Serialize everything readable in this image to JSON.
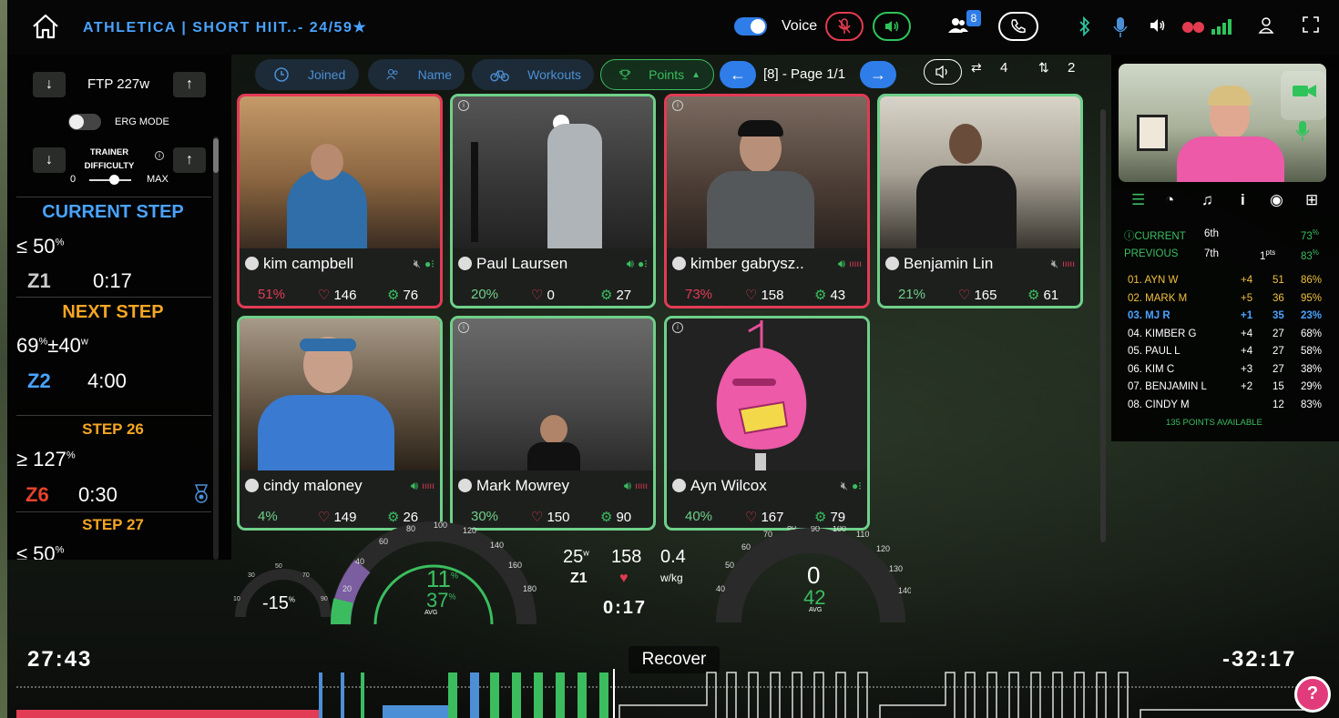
{
  "header": {
    "title": "ATHLETICA | SHORT HIIT..- 24/59★",
    "voice_label": "Voice",
    "participant_count": "8"
  },
  "left": {
    "ftp": "FTP 227w",
    "erg_label": "ERG MODE",
    "trainer_label_1": "TRAINER",
    "trainer_label_2": "DIFFICULTY",
    "min_label": "0",
    "max_label": "MAX",
    "current_step_title": "CURRENT STEP",
    "current_target": "≤ 50",
    "current_target_unit": "%",
    "current_zone": "Z1",
    "current_time": "0:17",
    "next_step_title": "NEXT STEP",
    "next_target": "69",
    "next_target_sup": "%",
    "next_target_range": "±40",
    "next_target_unit": "w",
    "next_zone": "Z2",
    "next_time": "4:00",
    "step26_title": "STEP 26",
    "step26_target": "≥ 127",
    "step26_unit": "%",
    "step26_zone": "Z6",
    "step26_time": "0:30",
    "step27_title": "STEP 27",
    "step27_target": "≤ 50",
    "step27_unit": "%"
  },
  "toolbar": {
    "joined": "Joined",
    "name": "Name",
    "workouts": "Workouts",
    "points": "Points",
    "page": "[8] - Page 1/1",
    "swap_count": "4",
    "sort_count": "2"
  },
  "tiles": [
    {
      "name": "kim campbell",
      "pct": "51%",
      "hr": "146",
      "cad": "76"
    },
    {
      "name": "Paul Laursen",
      "pct": "20%",
      "hr": "0",
      "cad": "27"
    },
    {
      "name": "kimber gabrysz..",
      "pct": "73%",
      "hr": "158",
      "cad": "43"
    },
    {
      "name": "Benjamin Lin",
      "pct": "21%",
      "hr": "165",
      "cad": "61"
    },
    {
      "name": "cindy maloney",
      "pct": "4%",
      "hr": "149",
      "cad": "26"
    },
    {
      "name": "Mark Mowrey",
      "pct": "30%",
      "hr": "150",
      "cad": "90"
    },
    {
      "name": "Ayn Wilcox",
      "pct": "40%",
      "hr": "167",
      "cad": "79"
    }
  ],
  "right": {
    "current_label": "CURRENT",
    "current_rank": "6th",
    "current_pct": "73",
    "current_pct_unit": "%",
    "previous_label": "PREVIOUS",
    "previous_rank": "7th",
    "previous_pts": "1",
    "previous_pts_unit": "pts",
    "previous_pct": "83",
    "previous_pct_unit": "%",
    "leaderboard": [
      {
        "name": "01. AYN W",
        "delta": "+4",
        "pts": "51",
        "pct": "86%"
      },
      {
        "name": "02. MARK M",
        "delta": "+5",
        "pts": "36",
        "pct": "95%"
      },
      {
        "name": "03. MJ R",
        "delta": "+1",
        "pts": "35",
        "pct": "23%"
      },
      {
        "name": "04. KIMBER G",
        "delta": "+4",
        "pts": "27",
        "pct": "68%"
      },
      {
        "name": "05. PAUL L",
        "delta": "+4",
        "pts": "27",
        "pct": "58%"
      },
      {
        "name": "06. KIM C",
        "delta": "+3",
        "pts": "27",
        "pct": "38%"
      },
      {
        "name": "07. BENJAMIN L",
        "delta": "+2",
        "pts": "15",
        "pct": "29%"
      },
      {
        "name": "08. CINDY M",
        "delta": "",
        "pts": "12",
        "pct": "83%"
      }
    ],
    "points_available": "135 POINTS AVAILABLE"
  },
  "gauges": {
    "balance_value": "-15",
    "balance_unit": "%",
    "balance_ticks": [
      "10",
      "30",
      "50",
      "70",
      "90"
    ],
    "power_value": "11",
    "power_avg": "37",
    "power_unit": "%",
    "power_ticks": [
      "20",
      "40",
      "60",
      "80",
      "100",
      "120",
      "140",
      "160",
      "180"
    ],
    "avg_label": "AVG",
    "watts": "25",
    "watts_unit": "w",
    "zone": "Z1",
    "hr": "158",
    "wkg": "0.4",
    "wkg_unit": "w/kg",
    "step_timer": "0:17",
    "cad_value": "0",
    "cad_avg": "42",
    "cad_ticks": [
      "40",
      "50",
      "60",
      "70",
      "80",
      "90",
      "100",
      "110",
      "120",
      "130",
      "140"
    ]
  },
  "bottom": {
    "elapsed": "27:43",
    "remaining": "-32:17",
    "current_step_name": "Recover",
    "help": "?"
  },
  "colors": {
    "blue": "#4aa3ff",
    "green": "#3bbd5f",
    "red": "#e23b4f",
    "orange": "#f5a623",
    "gold": "#f0c040"
  },
  "workout_bars": [
    {
      "type": "red",
      "w": 0,
      "h": 0
    },
    {
      "type": "blue",
      "value": 1
    },
    {
      "type": "green",
      "value": 1
    }
  ]
}
